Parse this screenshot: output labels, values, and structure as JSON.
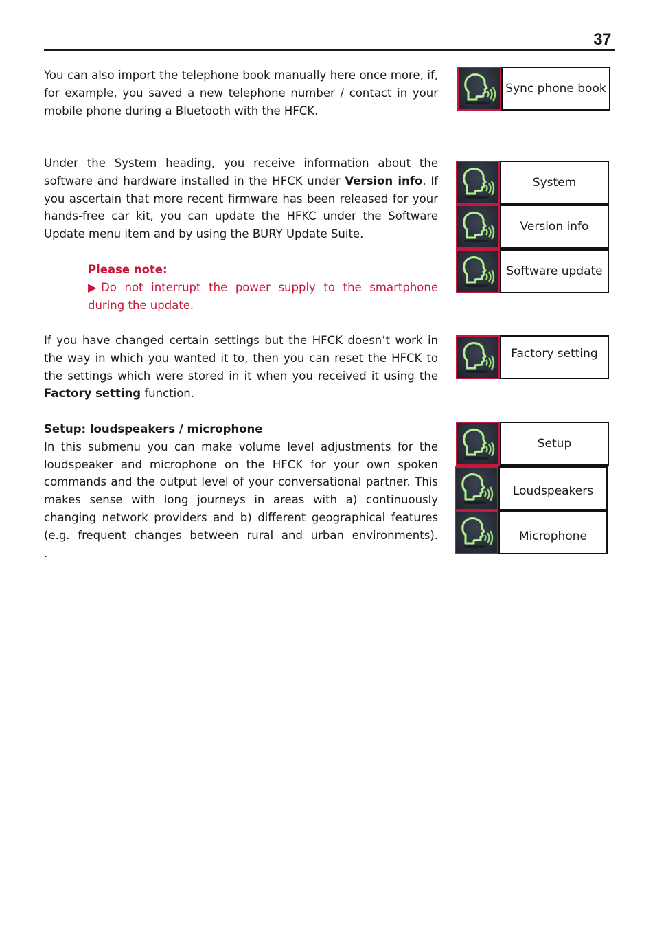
{
  "page": {
    "number": "37"
  },
  "sections": {
    "sync": {
      "text": "You can also import the telephone book manually here once more, if, for example, you saved a new telephone number / contact in your mobile phone during a Bluetooth with the HFCK.",
      "menu": [
        "Sync phone book"
      ]
    },
    "system": {
      "text_before": "Under the System heading, you receive information about the software and hardware installed in the HFCK under ",
      "text_bold": "Version info",
      "text_after": ". If you ascertain that more recent firmware has been released for your hands-free car kit, you can update the HFKC under the Software Update menu item and by using the BURY Update Suite.",
      "note_title": "Please note:",
      "note_bullet": "▶",
      "note_text": "Do not interrupt the power supply to the smartphone during the update.",
      "menu": [
        "System",
        "Version info",
        "Software update"
      ]
    },
    "factory": {
      "text_before": "If you have changed certain settings but the HFCK doesn’t work in the way in which you wanted it to, then you can reset the HFCK to the settings which were stored in it when you received it using the ",
      "text_bold": "Factory setting",
      "text_after": " function.",
      "menu": [
        "Factory setting"
      ]
    },
    "setup": {
      "heading": "Setup: loudspeakers / microphone",
      "text": "In this submenu you can make volume level adjustments for the loudspeaker and microphone on the HFCK for your own spoken commands and the output level of your conversational partner. This makes sense with long journeys in areas with a) continuously changing network providers and b) different geographical features (e.g. frequent changes between rural and urban environments).",
      "trailing": ".",
      "menu": [
        "Setup",
        "Loudspeakers",
        "Microphone"
      ]
    }
  },
  "icon": {
    "name": "voice-head-icon",
    "accent": "#c8173c",
    "glow": "#9be07a"
  }
}
